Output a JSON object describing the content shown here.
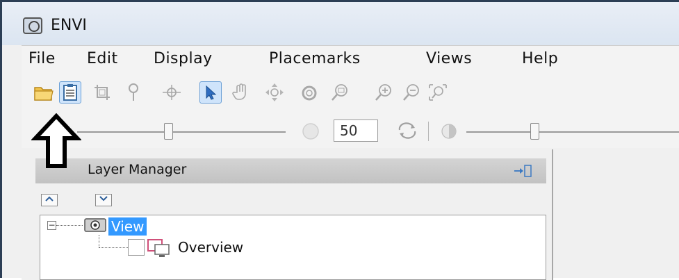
{
  "window": {
    "title": "ENVI"
  },
  "menu": {
    "items": [
      "File",
      "Edit",
      "Display",
      "Placemarks",
      "Views",
      "Help"
    ]
  },
  "toolbar": {
    "icons": [
      "open-folder-icon",
      "data-manager-icon",
      "crop-icon",
      "pin-icon",
      "crosshair-icon",
      "select-pointer-icon",
      "pan-hand-icon",
      "fly-icon",
      "rotate-icon",
      "zoom-icon",
      "zoom-in-icon",
      "zoom-out-icon",
      "zoom-fit-icon"
    ],
    "selected": "select-pointer-icon"
  },
  "controls": {
    "zoom_value": "50"
  },
  "layer_manager": {
    "title": "Layer Manager",
    "tree": {
      "root_label": "View",
      "child_label": "Overview"
    }
  },
  "colors": {
    "selection": "#3399ff",
    "frame": "#2c3e55",
    "arrow": "#000000"
  }
}
